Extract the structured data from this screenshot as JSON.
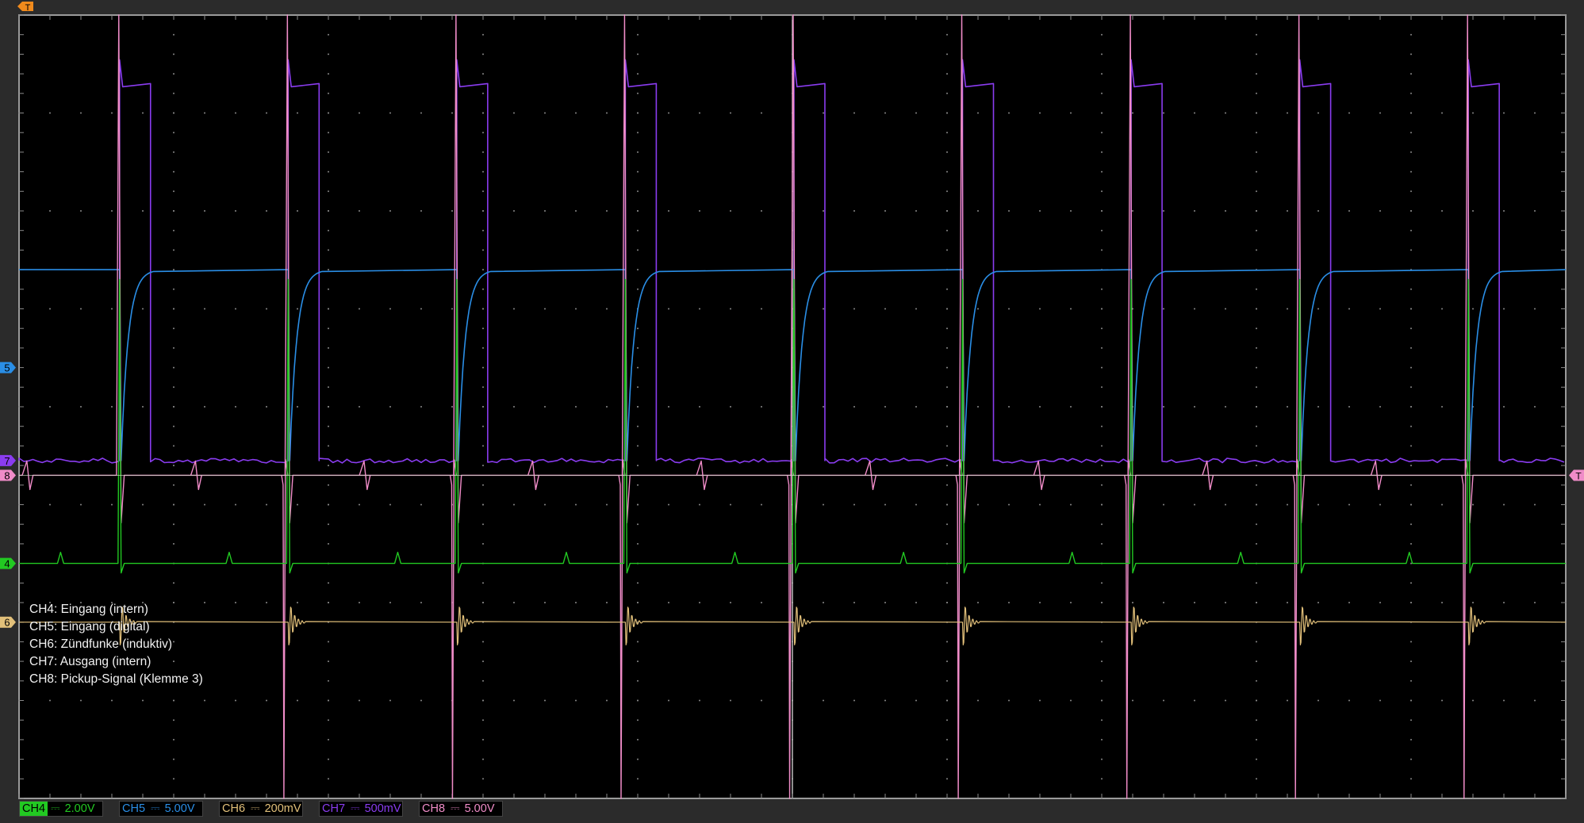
{
  "legend": [
    "CH4: Eingang (intern)",
    "CH5: Eingang (digital)",
    "CH6: Zündfunke (induktiv)",
    "CH7: Ausgang (intern)",
    "CH8: Pickup-Signal (Klemme 3)"
  ],
  "colors": {
    "background": "#000000",
    "frame": "#2b2b2b",
    "grid": "#8a8a8a",
    "ch4": "#22c922",
    "ch5": "#2a8ee6",
    "ch6": "#e2c07a",
    "ch7": "#8a3cf0",
    "ch8": "#f08cc8",
    "trigger": "#f08a1c"
  },
  "channels": [
    {
      "id": "ch4",
      "name": "CH4",
      "marker": "4",
      "coupling": "⎓",
      "scale": "2.00V",
      "color": "#22c922",
      "highlight": true
    },
    {
      "id": "ch5",
      "name": "CH5",
      "marker": "5",
      "coupling": "⎓",
      "scale": "5.00V",
      "color": "#2a8ee6",
      "highlight": false
    },
    {
      "id": "ch6",
      "name": "CH6",
      "marker": "6",
      "coupling": "⎓",
      "scale": "200mV",
      "color": "#e2c07a",
      "highlight": false
    },
    {
      "id": "ch7",
      "name": "CH7",
      "marker": "7",
      "coupling": "⎓",
      "scale": "500mV",
      "color": "#8a3cf0",
      "highlight": false
    },
    {
      "id": "ch8",
      "name": "CH8",
      "marker": "8",
      "coupling": "⎓",
      "scale": "5.00V",
      "color": "#f08cc8",
      "highlight": false
    }
  ],
  "trigger": {
    "top_marker": "T",
    "right_marker": "T"
  },
  "chart_data": {
    "type": "line",
    "grid": true,
    "divisions": {
      "x": 10,
      "y": 8
    },
    "period_div": 1.09,
    "cycles": 9,
    "first_edge_div": 0.65,
    "levels": {
      "ch5": {
        "high_div": 2.6,
        "low_div": 4.55
      },
      "ch7": {
        "low_div": 4.55,
        "high_div": 0.7,
        "pulse_width_div": 0.2
      },
      "ch8": {
        "base_div": 4.7,
        "spike_up_div": 0.0,
        "spike_down_div": 8.0
      },
      "ch4": {
        "base_div": 5.6
      },
      "ch6": {
        "base_div": 6.2
      }
    }
  }
}
